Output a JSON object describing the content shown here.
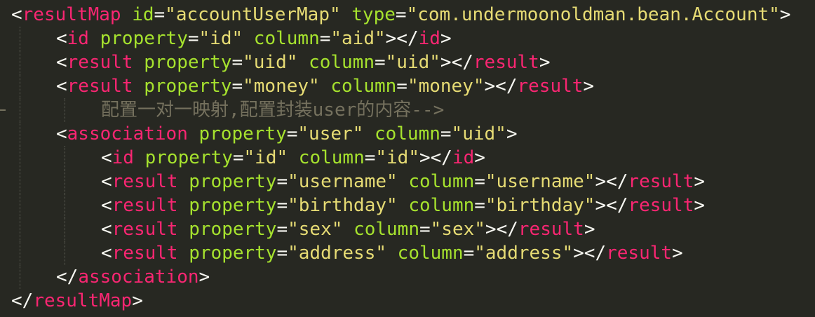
{
  "editor": {
    "theme_colors": {
      "background": "#272822",
      "punctuation": "#f8f8f2",
      "tag": "#f92672",
      "attribute": "#a6e22e",
      "string": "#e6db74",
      "comment": "#75715e"
    },
    "lines": [
      {
        "indent": 0,
        "tokens": [
          {
            "type": "p",
            "text": "<"
          },
          {
            "type": "t",
            "text": "resultMap"
          },
          {
            "type": "p",
            "text": " "
          },
          {
            "type": "a",
            "text": "id"
          },
          {
            "type": "p",
            "text": "="
          },
          {
            "type": "s",
            "text": "\"accountUserMap\""
          },
          {
            "type": "p",
            "text": " "
          },
          {
            "type": "a",
            "text": "type"
          },
          {
            "type": "p",
            "text": "="
          },
          {
            "type": "s",
            "text": "\"com.undermoonoldman.bean.Account\""
          },
          {
            "type": "p",
            "text": ">"
          }
        ]
      },
      {
        "indent": 1,
        "tokens": [
          {
            "type": "p",
            "text": "<"
          },
          {
            "type": "t",
            "text": "id"
          },
          {
            "type": "p",
            "text": " "
          },
          {
            "type": "a",
            "text": "property"
          },
          {
            "type": "p",
            "text": "="
          },
          {
            "type": "s",
            "text": "\"id\""
          },
          {
            "type": "p",
            "text": " "
          },
          {
            "type": "a",
            "text": "column"
          },
          {
            "type": "p",
            "text": "="
          },
          {
            "type": "s",
            "text": "\"aid\""
          },
          {
            "type": "p",
            "text": "></"
          },
          {
            "type": "t",
            "text": "id"
          },
          {
            "type": "p",
            "text": ">"
          }
        ]
      },
      {
        "indent": 1,
        "tokens": [
          {
            "type": "p",
            "text": "<"
          },
          {
            "type": "t",
            "text": "result"
          },
          {
            "type": "p",
            "text": " "
          },
          {
            "type": "a",
            "text": "property"
          },
          {
            "type": "p",
            "text": "="
          },
          {
            "type": "s",
            "text": "\"uid\""
          },
          {
            "type": "p",
            "text": " "
          },
          {
            "type": "a",
            "text": "column"
          },
          {
            "type": "p",
            "text": "="
          },
          {
            "type": "s",
            "text": "\"uid\""
          },
          {
            "type": "p",
            "text": "></"
          },
          {
            "type": "t",
            "text": "result"
          },
          {
            "type": "p",
            "text": ">"
          }
        ]
      },
      {
        "indent": 1,
        "tokens": [
          {
            "type": "p",
            "text": "<"
          },
          {
            "type": "t",
            "text": "result"
          },
          {
            "type": "p",
            "text": " "
          },
          {
            "type": "a",
            "text": "property"
          },
          {
            "type": "p",
            "text": "="
          },
          {
            "type": "s",
            "text": "\"money\""
          },
          {
            "type": "p",
            "text": " "
          },
          {
            "type": "a",
            "text": "column"
          },
          {
            "type": "p",
            "text": "="
          },
          {
            "type": "s",
            "text": "\"money\""
          },
          {
            "type": "p",
            "text": "></"
          },
          {
            "type": "t",
            "text": "result"
          },
          {
            "type": "p",
            "text": ">"
          }
        ]
      },
      {
        "indent": 2,
        "gutter_mark": true,
        "tokens": [
          {
            "type": "c",
            "text": "配置一对一映射,配置封装user的内容-->"
          }
        ]
      },
      {
        "indent": 1,
        "tokens": [
          {
            "type": "p",
            "text": "<"
          },
          {
            "type": "t",
            "text": "association"
          },
          {
            "type": "p",
            "text": " "
          },
          {
            "type": "a",
            "text": "property"
          },
          {
            "type": "p",
            "text": "="
          },
          {
            "type": "s",
            "text": "\"user\""
          },
          {
            "type": "p",
            "text": " "
          },
          {
            "type": "a",
            "text": "column"
          },
          {
            "type": "p",
            "text": "="
          },
          {
            "type": "s",
            "text": "\"uid\""
          },
          {
            "type": "p",
            "text": ">"
          }
        ]
      },
      {
        "indent": 2,
        "tokens": [
          {
            "type": "p",
            "text": "<"
          },
          {
            "type": "t",
            "text": "id"
          },
          {
            "type": "p",
            "text": " "
          },
          {
            "type": "a",
            "text": "property"
          },
          {
            "type": "p",
            "text": "="
          },
          {
            "type": "s",
            "text": "\"id\""
          },
          {
            "type": "p",
            "text": " "
          },
          {
            "type": "a",
            "text": "column"
          },
          {
            "type": "p",
            "text": "="
          },
          {
            "type": "s",
            "text": "\"id\""
          },
          {
            "type": "p",
            "text": "></"
          },
          {
            "type": "t",
            "text": "id"
          },
          {
            "type": "p",
            "text": ">"
          }
        ]
      },
      {
        "indent": 2,
        "tokens": [
          {
            "type": "p",
            "text": "<"
          },
          {
            "type": "t",
            "text": "result"
          },
          {
            "type": "p",
            "text": " "
          },
          {
            "type": "a",
            "text": "property"
          },
          {
            "type": "p",
            "text": "="
          },
          {
            "type": "s",
            "text": "\"username\""
          },
          {
            "type": "p",
            "text": " "
          },
          {
            "type": "a",
            "text": "column"
          },
          {
            "type": "p",
            "text": "="
          },
          {
            "type": "s",
            "text": "\"username\""
          },
          {
            "type": "p",
            "text": "></"
          },
          {
            "type": "t",
            "text": "result"
          },
          {
            "type": "p",
            "text": ">"
          }
        ]
      },
      {
        "indent": 2,
        "tokens": [
          {
            "type": "p",
            "text": "<"
          },
          {
            "type": "t",
            "text": "result"
          },
          {
            "type": "p",
            "text": " "
          },
          {
            "type": "a",
            "text": "property"
          },
          {
            "type": "p",
            "text": "="
          },
          {
            "type": "s",
            "text": "\"birthday\""
          },
          {
            "type": "p",
            "text": " "
          },
          {
            "type": "a",
            "text": "column"
          },
          {
            "type": "p",
            "text": "="
          },
          {
            "type": "s",
            "text": "\"birthday\""
          },
          {
            "type": "p",
            "text": "></"
          },
          {
            "type": "t",
            "text": "result"
          },
          {
            "type": "p",
            "text": ">"
          }
        ]
      },
      {
        "indent": 2,
        "tokens": [
          {
            "type": "p",
            "text": "<"
          },
          {
            "type": "t",
            "text": "result"
          },
          {
            "type": "p",
            "text": " "
          },
          {
            "type": "a",
            "text": "property"
          },
          {
            "type": "p",
            "text": "="
          },
          {
            "type": "s",
            "text": "\"sex\""
          },
          {
            "type": "p",
            "text": " "
          },
          {
            "type": "a",
            "text": "column"
          },
          {
            "type": "p",
            "text": "="
          },
          {
            "type": "s",
            "text": "\"sex\""
          },
          {
            "type": "p",
            "text": "></"
          },
          {
            "type": "t",
            "text": "result"
          },
          {
            "type": "p",
            "text": ">"
          }
        ]
      },
      {
        "indent": 2,
        "tokens": [
          {
            "type": "p",
            "text": "<"
          },
          {
            "type": "t",
            "text": "result"
          },
          {
            "type": "p",
            "text": " "
          },
          {
            "type": "a",
            "text": "property"
          },
          {
            "type": "p",
            "text": "="
          },
          {
            "type": "s",
            "text": "\"address\""
          },
          {
            "type": "p",
            "text": " "
          },
          {
            "type": "a",
            "text": "column"
          },
          {
            "type": "p",
            "text": "="
          },
          {
            "type": "s",
            "text": "\"address\""
          },
          {
            "type": "p",
            "text": "></"
          },
          {
            "type": "t",
            "text": "result"
          },
          {
            "type": "p",
            "text": ">"
          }
        ]
      },
      {
        "indent": 1,
        "tokens": [
          {
            "type": "p",
            "text": "</"
          },
          {
            "type": "t",
            "text": "association"
          },
          {
            "type": "p",
            "text": ">"
          }
        ]
      },
      {
        "indent": 0,
        "tokens": [
          {
            "type": "p",
            "text": "</"
          },
          {
            "type": "t",
            "text": "resultMap"
          },
          {
            "type": "p",
            "text": ">"
          }
        ]
      }
    ]
  }
}
